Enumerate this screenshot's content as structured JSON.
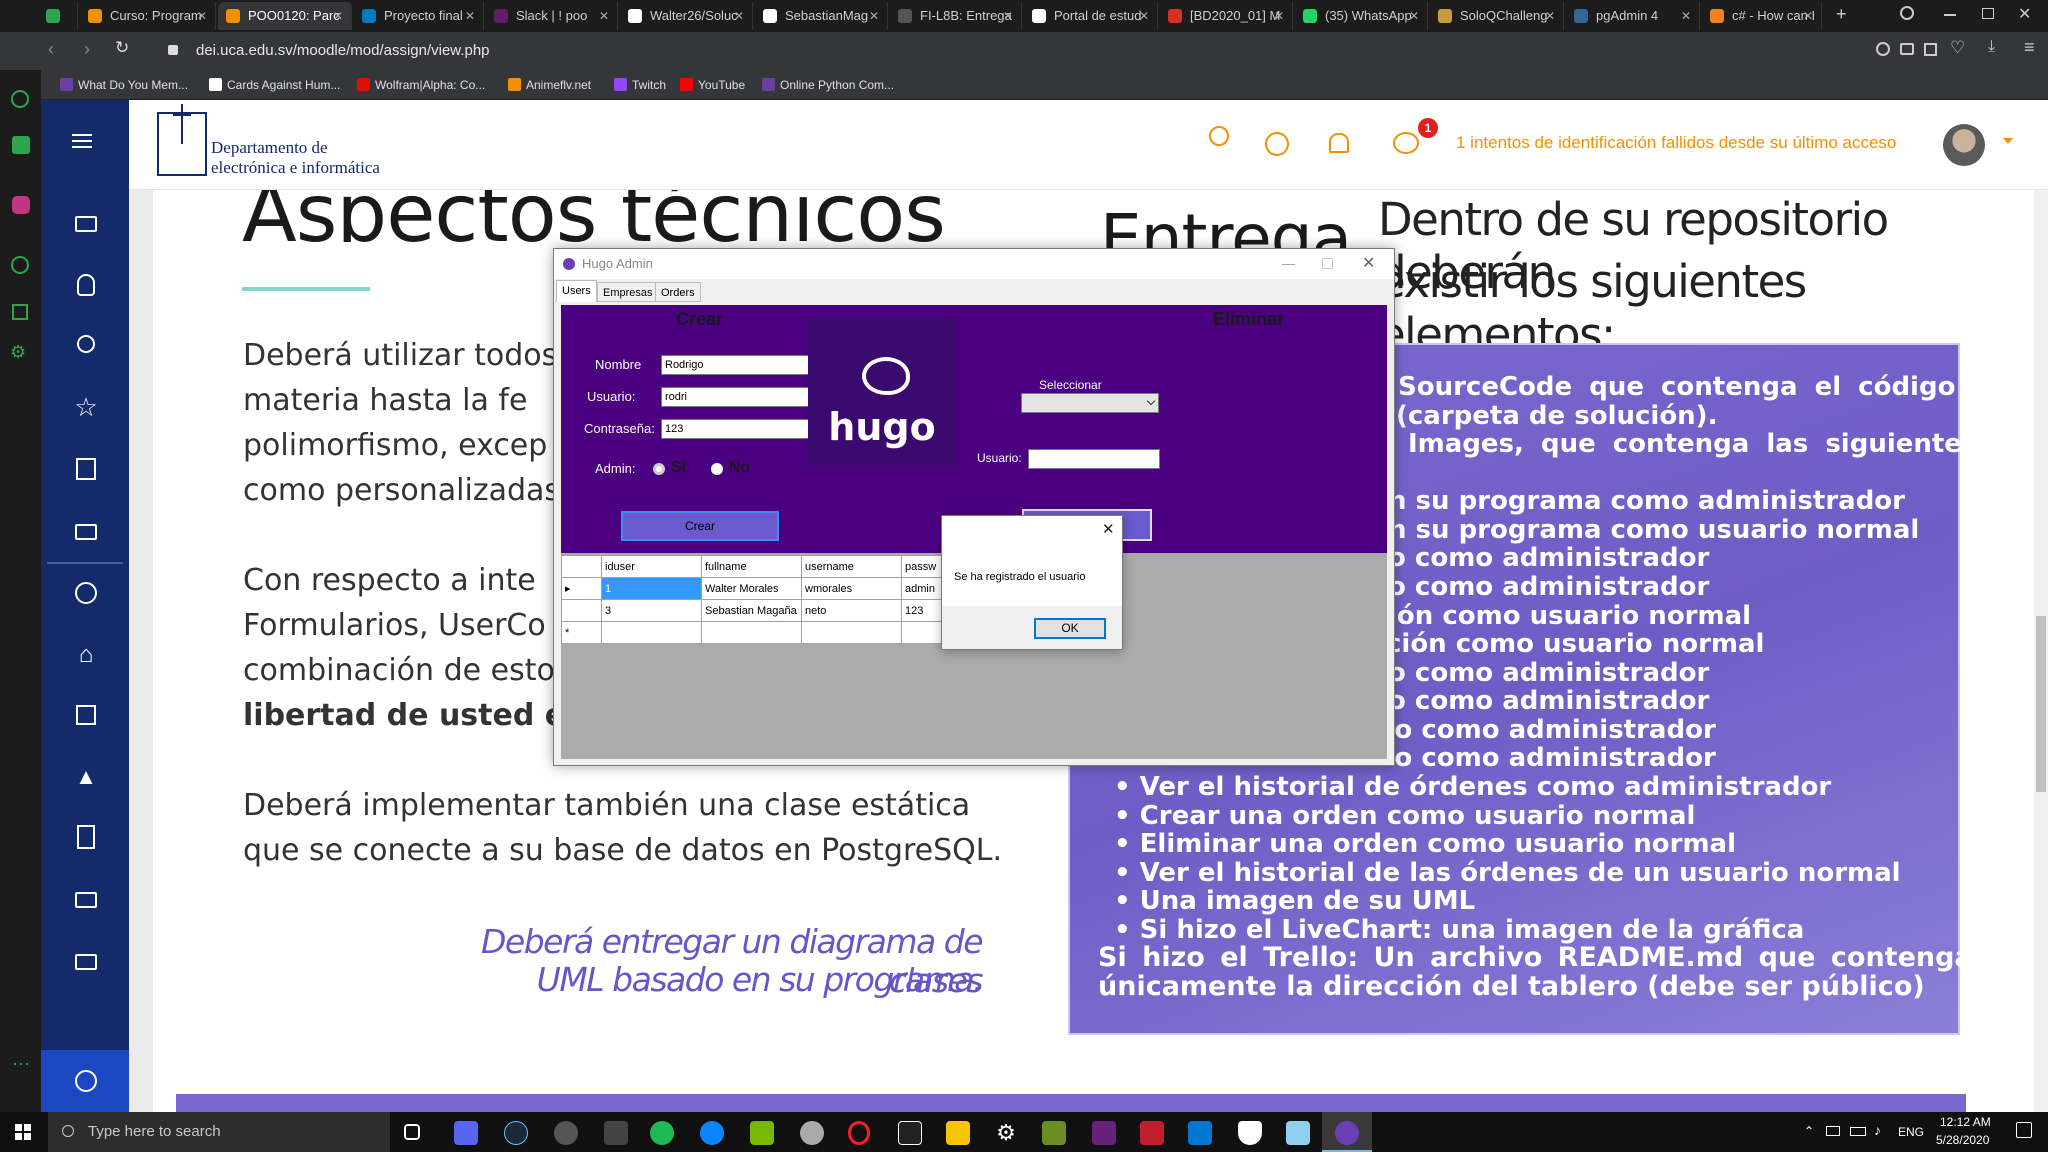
{
  "browser": {
    "tabs": [
      {
        "label": "",
        "color": "#2ea44f"
      },
      {
        "label": "Curso: Program",
        "color": "#f29100"
      },
      {
        "label": "POO0120: Parc",
        "color": "#f29100"
      },
      {
        "label": "Proyecto final",
        "color": "#0079bf"
      },
      {
        "label": "Slack | ! poo",
        "color": "#611f69"
      },
      {
        "label": "Walter26/Soluc",
        "color": "#ffffff"
      },
      {
        "label": "SebastianMag",
        "color": "#ffffff"
      },
      {
        "label": "FI-L8B: Entrega",
        "color": "#555555"
      },
      {
        "label": "Portal de estud",
        "color": "#ffffff"
      },
      {
        "label": "[BD2020_01] M",
        "color": "#d93025"
      },
      {
        "label": "(35) WhatsApp",
        "color": "#25d366"
      },
      {
        "label": "SoloQChalleng",
        "color": "#c89b3c"
      },
      {
        "label": "pgAdmin 4",
        "color": "#336791"
      },
      {
        "label": "c# - How can I",
        "color": "#f48024"
      }
    ],
    "url": "dei.uca.edu.sv/moodle/mod/assign/view.php",
    "bookmarks": [
      {
        "label": "What Do You Mem...",
        "color": "#6b3fa0"
      },
      {
        "label": "Cards Against Hum...",
        "color": "#ffffff"
      },
      {
        "label": "Wolfram|Alpha: Co...",
        "color": "#dd1100"
      },
      {
        "label": "Animeflv.net",
        "color": "#f29100"
      },
      {
        "label": "Twitch",
        "color": "#9146ff"
      },
      {
        "label": "YouTube",
        "color": "#ff0000"
      },
      {
        "label": "Online Python Com...",
        "color": "#6b3fa0"
      }
    ]
  },
  "moodle": {
    "logo_line1": "Departamento de",
    "logo_line2": "electrónica e informática",
    "notification_count": "1",
    "failed_login_text": "1 intentos de identificación fallidos desde su último acceso"
  },
  "content": {
    "heading": "Aspectos técnicos",
    "para1": [
      "Deberá utilizar todos",
      "materia hasta la fe",
      "polimorfismo, excep",
      "como personalizadas"
    ],
    "para2": [
      "Con respecto a inte",
      "Formularios, UserCo",
      "combinación de esto"
    ],
    "para2_bold": "libertad de usted es",
    "para3": [
      "Deberá implementar también una clase estática",
      "que se conecte a su base de datos en PostgreSQL."
    ],
    "italic": [
      "Deberá entregar un diagrama de clases",
      "UML basado en su programa."
    ],
    "entrega_heading": "Entrega",
    "entrega_sub": [
      "Dentro de su repositorio deberán",
      "existir los siguientes elementos:"
    ],
    "purple_lines": [
      "SourceCode que contenga el código",
      "(carpeta de solución).",
      "Images, que contenga las siguientes",
      "n su programa como administrador",
      "n su programa como usuario normal",
      "o como administrador",
      "o como administrador",
      "ión como usuario normal",
      "ción como usuario normal",
      "o como administrador",
      "o como administrador",
      "to como administrador",
      "to como administrador"
    ],
    "bullets": [
      "Ver el historial de órdenes como administrador",
      "Crear una orden como usuario normal",
      "Eliminar una orden como usuario normal",
      "Ver el historial de las órdenes de un usuario normal",
      "Una imagen de su UML",
      "Si hizo el LiveChart: una imagen de la gráfica"
    ],
    "trello": [
      "Si hizo el Trello: Un archivo README.md que contenga",
      "únicamente la dirección del tablero (debe ser público)"
    ]
  },
  "app": {
    "title": "Hugo Admin",
    "tabs": [
      "Users",
      "Empresas",
      "Orders"
    ],
    "crear_title": "Crear",
    "eliminar_title": "Eliminar",
    "labels": {
      "nombre": "Nombre",
      "usuario": "Usuario:",
      "contrasena": "Contraseña:",
      "admin": "Admin:",
      "si": "Si",
      "no": "No",
      "seleccionar": "Seleccionar",
      "usuario2": "Usuario:"
    },
    "values": {
      "nombre": "Rodrigo",
      "usuario": "rodri",
      "contrasena": "123"
    },
    "admin_selected": "Si",
    "crear_button": "Crear",
    "eliminar_button": "Eliminar",
    "logo_text": "hugo",
    "grid": {
      "columns": [
        "iduser",
        "fullname",
        "username",
        "passw"
      ],
      "rows": [
        [
          "1",
          "Walter Morales",
          "wmorales",
          "admin"
        ],
        [
          "3",
          "Sebastian Magaña",
          "neto",
          "123"
        ]
      ],
      "new_row_marker": "*"
    }
  },
  "dialog": {
    "message": "Se ha registrado el usuario",
    "ok": "OK"
  },
  "taskbar": {
    "search_placeholder": "Type here to search",
    "time": "12:12 AM",
    "date": "5/28/2020",
    "lang": "ENG"
  }
}
